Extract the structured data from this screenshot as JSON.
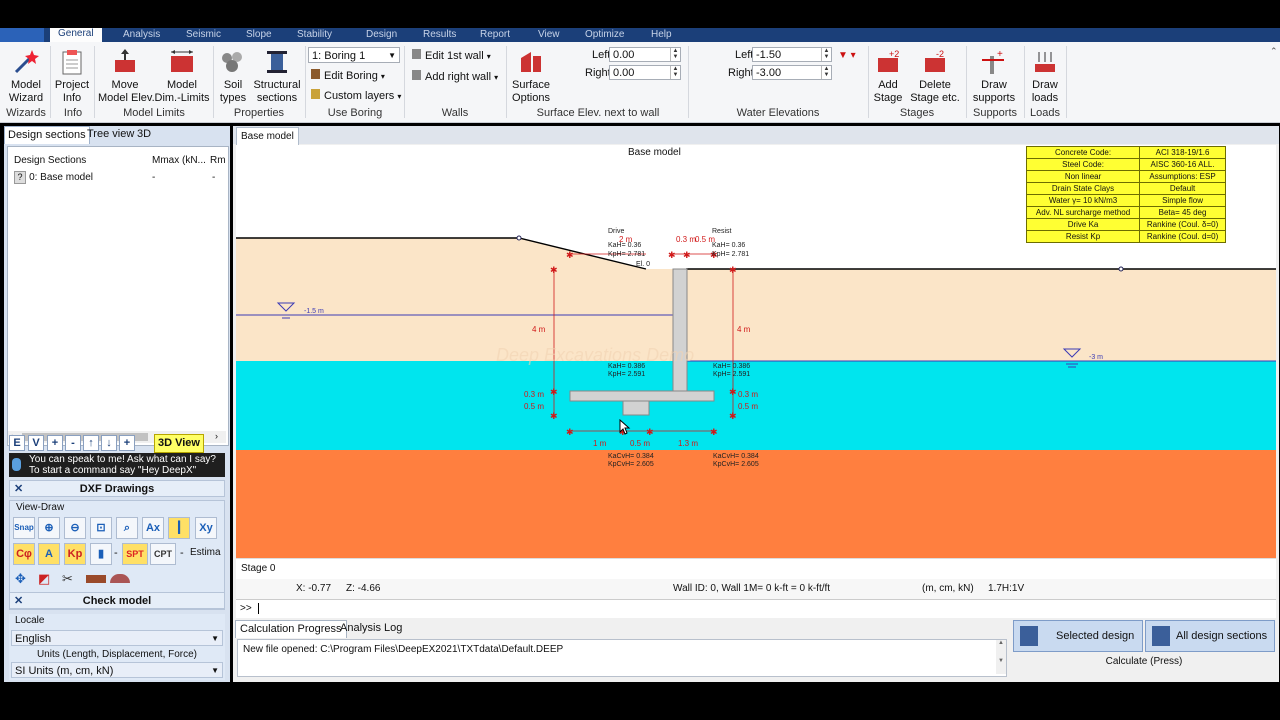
{
  "menu": {
    "tabs": [
      "General",
      "Analysis",
      "Seismic",
      "Slope",
      "Stability",
      "Design",
      "Results",
      "Report",
      "View",
      "Optimize",
      "Help"
    ]
  },
  "ribbon": {
    "wizards": {
      "button": "Model\nWizard",
      "group": "Wizards"
    },
    "info": {
      "button": "Project\nInfo",
      "group": "Info"
    },
    "model_limits": {
      "move": "Move\nModel Elev.",
      "dim": "Model\nDim.-Limits",
      "group": "Model Limits"
    },
    "properties": {
      "soil": "Soil\ntypes",
      "structural": "Structural\nsections",
      "group": "Properties"
    },
    "boring": {
      "select": "1: Boring 1",
      "edit": "Edit Boring",
      "custom": "Custom layers",
      "group": "Use Boring"
    },
    "walls": {
      "edit_first": "Edit 1st wall",
      "add_right": "Add right wall",
      "group": "Walls"
    },
    "surface": {
      "button": "Surface\nOptions",
      "left_label": "Left",
      "left_value": "0.00",
      "right_label": "Right",
      "right_value": "0.00",
      "group": "Surface Elev. next to wall"
    },
    "water": {
      "left_label": "Left",
      "left_value": "-1.50",
      "right_label": "Right",
      "right_value": "-3.00",
      "group": "Water Elevations"
    },
    "stages": {
      "add": "Add\nStage",
      "delete": "Delete\nStage etc.",
      "group": "Stages"
    },
    "supports": {
      "draw": "Draw\nsupports",
      "group": "Supports"
    },
    "loads": {
      "draw": "Draw\nloads",
      "group": "Loads"
    }
  },
  "left": {
    "tabs": [
      "Design sections",
      "Tree view",
      "3D"
    ],
    "columns": [
      "Design Sections",
      "Mmax (kN...",
      "Rm"
    ],
    "rows": [
      {
        "name": "0: Base model",
        "mmax": "-",
        "rm": "-"
      }
    ],
    "toolbar": [
      "E",
      "V",
      "+",
      "-",
      "↑",
      "↓",
      "+"
    ],
    "view3d": "3D View",
    "voice": "You can speak to me! Ask what can I say?\nTo start a command say \"Hey DeepX\"",
    "dxf": "DXF Drawings",
    "viewdraw": "View-Draw",
    "view_buttons": [
      "Snap",
      "",
      "",
      "",
      "",
      "Ax",
      "",
      "Xy"
    ],
    "view_buttons2": [
      "Cφ",
      "A",
      "Kp",
      "",
      "-",
      "SPT",
      "CPT",
      "-",
      "Estima"
    ],
    "check": "Check model",
    "locale_label": "Locale",
    "language": "English",
    "units_label": "Units (Length, Displacement, Force)",
    "units": "SI Units (m, cm, kN)"
  },
  "main": {
    "tab": "Base model",
    "title": "Base model",
    "watermark": "Deep Excavations Demo",
    "legend": [
      [
        "Concrete Code:",
        "ACI 318-19/1.6"
      ],
      [
        "Steel Code:",
        "AISC 360-16 ALL."
      ],
      [
        "Non linear",
        "Assumptions: ESP"
      ],
      [
        "Drain State Clays",
        "Default"
      ],
      [
        "Water γ= 10 kN/m3",
        "Simple flow"
      ],
      [
        "Adv. NL surcharge method",
        "Beta= 45 deg"
      ],
      [
        "Drive Ka",
        "Rankine (Coul. δ=0)"
      ],
      [
        "Resist Kp",
        "Rankine (Coul. d=0)"
      ]
    ],
    "labels": {
      "drive": "Drive",
      "resist": "Resist",
      "drive_ka": "KaH= 0.36",
      "drive_kp": "KpH= 2.781",
      "resist_ka": "KaH= 0.36",
      "resist_kp": "KpH= 2.781",
      "ka2_left": "KaH= 0.386",
      "kp2_left": "KpH= 2.591",
      "ka2_right": "KaH= 0.386",
      "kp2_right": "KpH= 2.591",
      "kacv_left": "KaCvH= 0.384",
      "kpcv_left": "KpCvH= 2.605",
      "kacv_right": "KaCvH= 0.384",
      "kpcv_right": "KpCvH= 2.605",
      "dim_2m": "2 m",
      "dim_03": "0.3 m",
      "dim_05": "0.5 m",
      "dim_4m_left": "4 m",
      "dim_4m_right": "4 m",
      "dim_03_l": "0.3 m",
      "dim_05_l": "0.5 m",
      "dim_03_r": "0.3 m",
      "dim_05_r": "0.5 m",
      "base_1m": "1 m",
      "base_05": "0.5 m",
      "base_13": "1.3 m",
      "water_left": "-1.5 m",
      "water_right": "-3 m",
      "el": "El. 0"
    },
    "stage": "Stage 0",
    "status": {
      "x": "X: -0.77",
      "z": "Z: -4.66",
      "wall": "Wall ID: 0, Wall 1M= 0 k-ft = 0 k-ft/ft",
      "units": "(m, cm, kN)",
      "ratio": "1.7H:1V"
    },
    "prompt": ">>"
  },
  "bottom": {
    "tabs": [
      "Calculation Progress",
      "Analysis Log"
    ],
    "log": "New file opened: C:\\Program Files\\DeepEX2021\\TXTdata\\Default.DEEP",
    "selected": "Selected design",
    "all": "All design sections",
    "calculate": "Calculate (Press)"
  },
  "colors": {
    "soil1": "#fbe5c8",
    "soil_water": "#00e5ee",
    "soil3": "#ff7f3f",
    "ribbon_blue": "#1b3f79"
  }
}
